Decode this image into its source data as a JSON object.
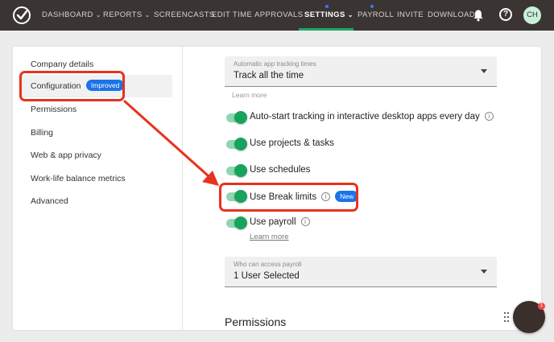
{
  "nav": {
    "items": [
      {
        "label": "DASHBOARD",
        "caret": "⌄"
      },
      {
        "label": "REPORTS",
        "caret": "⌄"
      },
      {
        "label": "SCREENCASTS"
      },
      {
        "label": "EDIT TIME"
      },
      {
        "label": "APPROVALS"
      },
      {
        "label": "SETTINGS",
        "caret": "⌄",
        "active": true
      },
      {
        "label": "PAYROLL"
      },
      {
        "label": "INVITE"
      },
      {
        "label": "DOWNLOAD"
      }
    ],
    "help_icon": "?",
    "avatar_initials": "CH",
    "bell_icon": "bell-icon",
    "logo_icon": "checkmark-logo-icon"
  },
  "sidebar": {
    "items": [
      {
        "label": "Company details"
      },
      {
        "label": "Configuration",
        "badge": "Improved",
        "selected": true
      },
      {
        "label": "Permissions"
      },
      {
        "label": "Billing"
      },
      {
        "label": "Web & app privacy"
      },
      {
        "label": "Work-life balance metrics"
      },
      {
        "label": "Advanced"
      }
    ]
  },
  "main": {
    "tracking_select": {
      "label": "Automatic app tracking times",
      "value": "Track all the time"
    },
    "learn_more_1": "Learn more",
    "toggles": [
      {
        "label": "Auto-start tracking in interactive desktop apps every day",
        "on": true,
        "info": "i"
      },
      {
        "label": "Use projects & tasks",
        "on": true
      },
      {
        "label": "Use schedules",
        "on": true
      },
      {
        "label": "Use Break limits",
        "on": true,
        "info": "i",
        "badge": "New"
      },
      {
        "label": "Use payroll",
        "on": true,
        "info": "i"
      }
    ],
    "learn_more_2": "Learn more",
    "payroll_select": {
      "label": "Who can access payroll",
      "value": "1 User Selected"
    },
    "permissions_title": "Permissions"
  },
  "chat": {
    "badge_count": "1"
  },
  "colors": {
    "topbar": "#3a3533",
    "accent_green": "#17a35b",
    "badge_blue": "#1a73e8",
    "annotation_red": "#e8321e"
  }
}
